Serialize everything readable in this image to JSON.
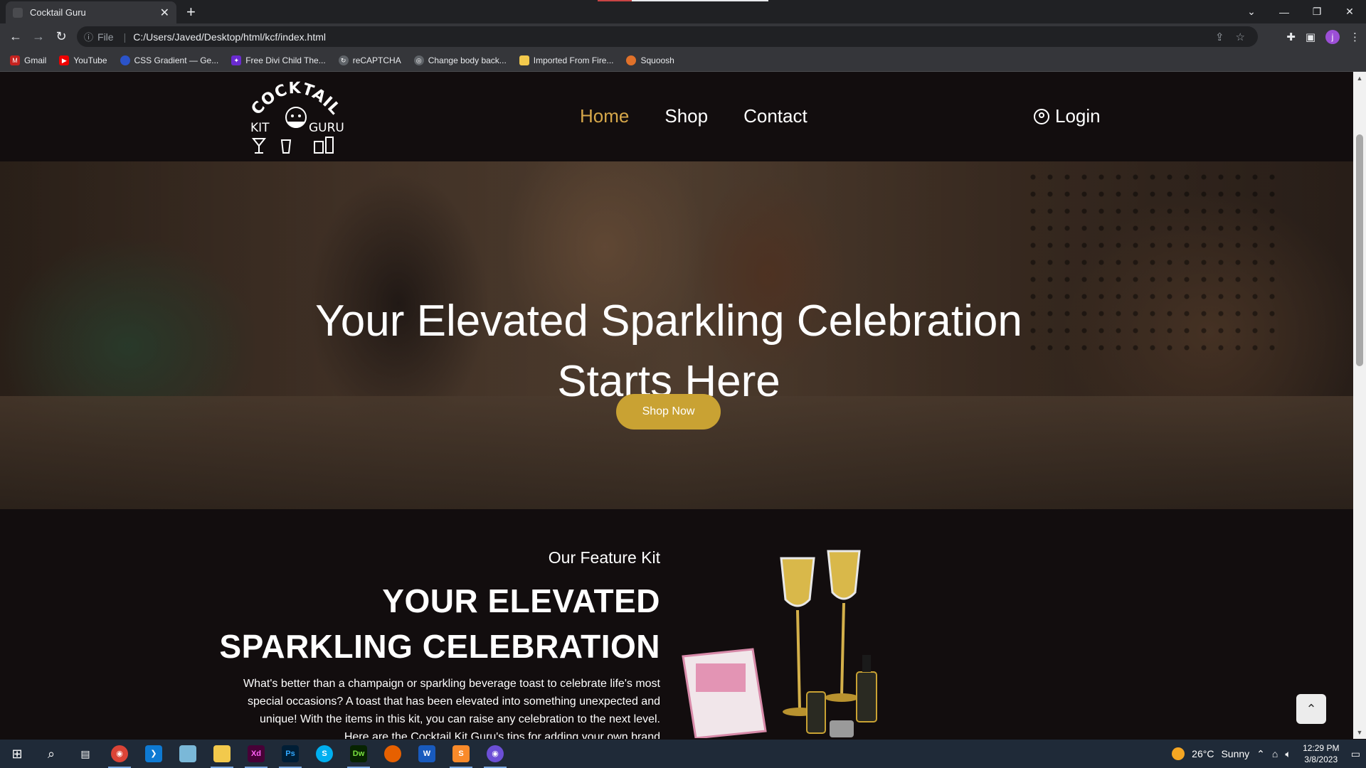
{
  "browser": {
    "tab_title": "Cocktail Guru",
    "address": "C:/Users/Javed/Desktop/html/kcf/index.html",
    "scheme_label": "File",
    "bookmarks": [
      "Gmail",
      "YouTube",
      "CSS Gradient — Ge...",
      "Free Divi Child The...",
      "reCAPTCHA",
      "Change body back...",
      "Imported From Fire...",
      "Squoosh"
    ],
    "profile_initial": "j"
  },
  "site": {
    "logo_text_top": "COCKTAIL",
    "logo_text_left": "KIT",
    "logo_text_right": "GURU",
    "nav": [
      "Home",
      "Shop",
      "Contact"
    ],
    "login_label": "Login"
  },
  "hero": {
    "title_line1": "Your Elevated Sparkling Celebration",
    "title_line2": "Starts Here",
    "cta_label": "Shop Now"
  },
  "feature": {
    "subtitle": "Our Feature Kit",
    "title_line1": "YOUR ELEVATED",
    "title_line2": "SPARKLING CELEBRATION",
    "body": "What's better than a champaign or sparkling beverage toast to celebrate life's most special occasions? A toast that has been elevated into something unexpected and unique! With the items in this kit, you can raise any celebration to the next level. Here are the Cocktail Kit Guru's tips for adding your own brand"
  },
  "taskbar": {
    "weather_temp": "26°C",
    "weather_text": "Sunny",
    "time": "12:29 PM",
    "date": "3/8/2023"
  },
  "colors": {
    "accent_gold": "#d6a74a",
    "button_gold": "#c9a233",
    "page_bg": "#120d0e"
  }
}
